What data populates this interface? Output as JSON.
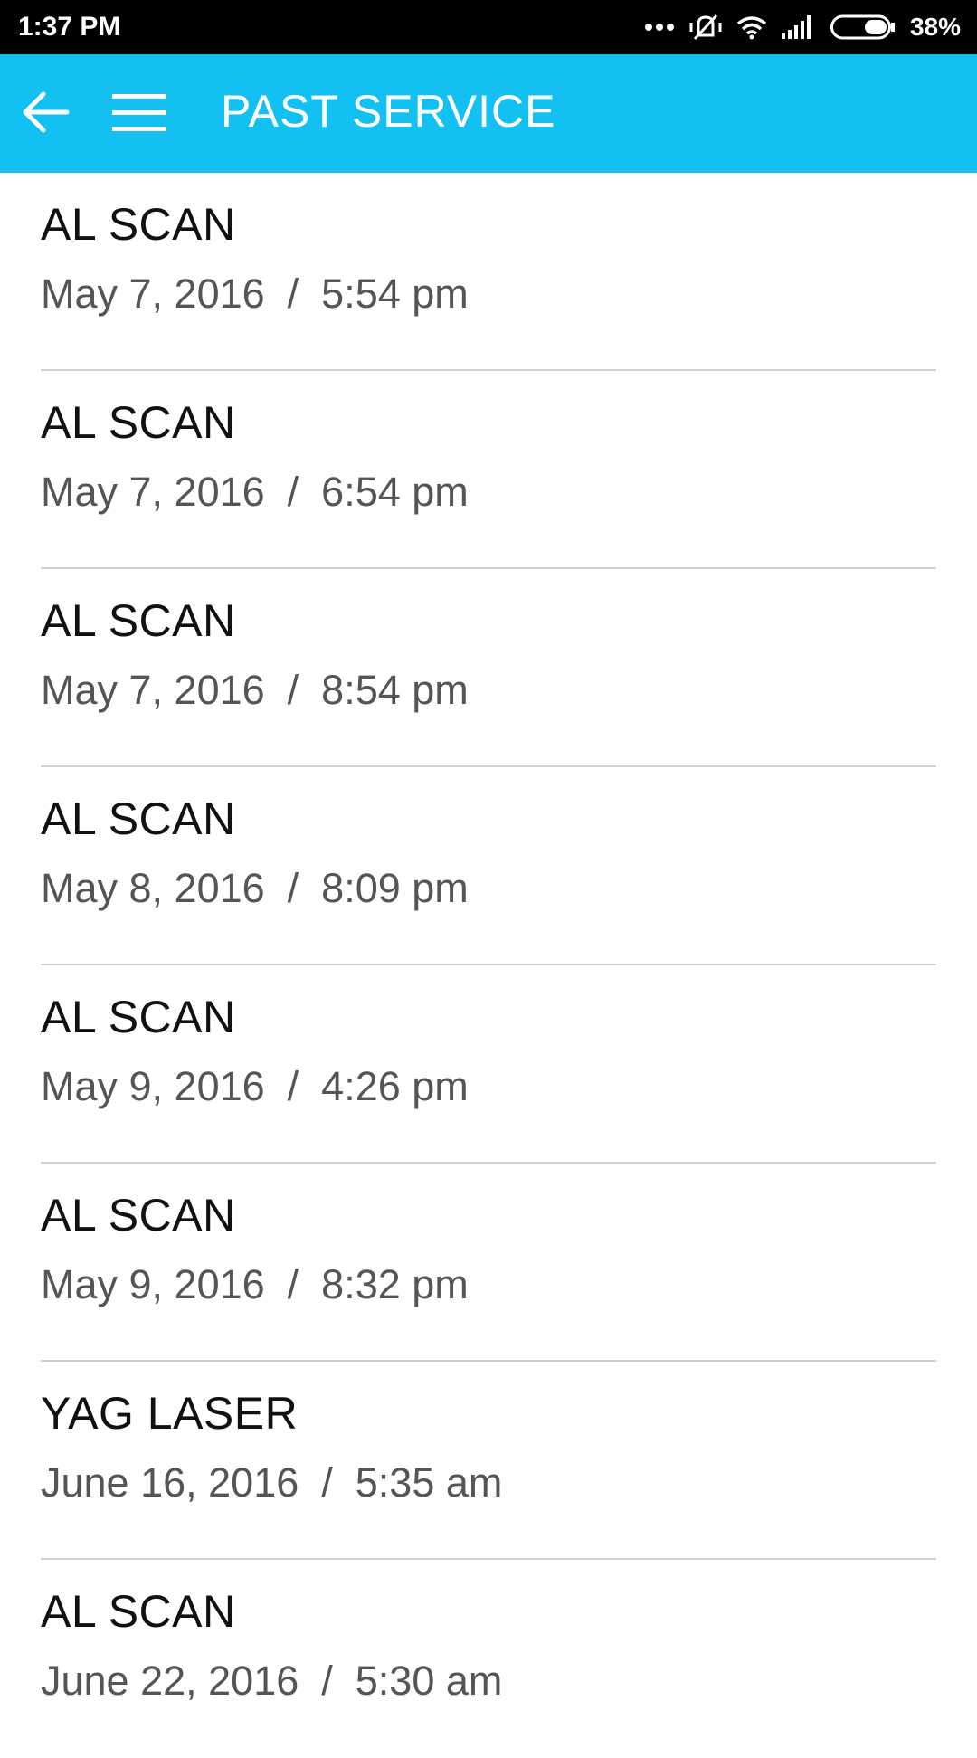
{
  "status_bar": {
    "time": "1:37 PM",
    "battery": "38%",
    "icons": [
      "more-dots-icon",
      "silent-vibrate-icon",
      "wifi-icon",
      "signal-icon",
      "battery-icon"
    ]
  },
  "app_bar": {
    "title": "PAST SERVICE",
    "back_icon": "arrow-left-icon",
    "menu_icon": "hamburger-menu-icon",
    "background": "#13c0f2"
  },
  "services": [
    {
      "name": "AL SCAN",
      "date": "May 7, 2016",
      "time": "5:54 pm"
    },
    {
      "name": "AL SCAN",
      "date": "May 7, 2016",
      "time": "6:54 pm"
    },
    {
      "name": "AL SCAN",
      "date": "May 7, 2016",
      "time": "8:54 pm"
    },
    {
      "name": "AL SCAN",
      "date": "May 8, 2016",
      "time": "8:09 pm"
    },
    {
      "name": "AL SCAN",
      "date": "May 9, 2016",
      "time": "4:26 pm"
    },
    {
      "name": "AL SCAN",
      "date": "May 9, 2016",
      "time": "8:32 pm"
    },
    {
      "name": "YAG LASER",
      "date": "June 16, 2016",
      "time": "5:35 am"
    },
    {
      "name": "AL SCAN",
      "date": "June 22, 2016",
      "time": "5:30 am"
    }
  ]
}
